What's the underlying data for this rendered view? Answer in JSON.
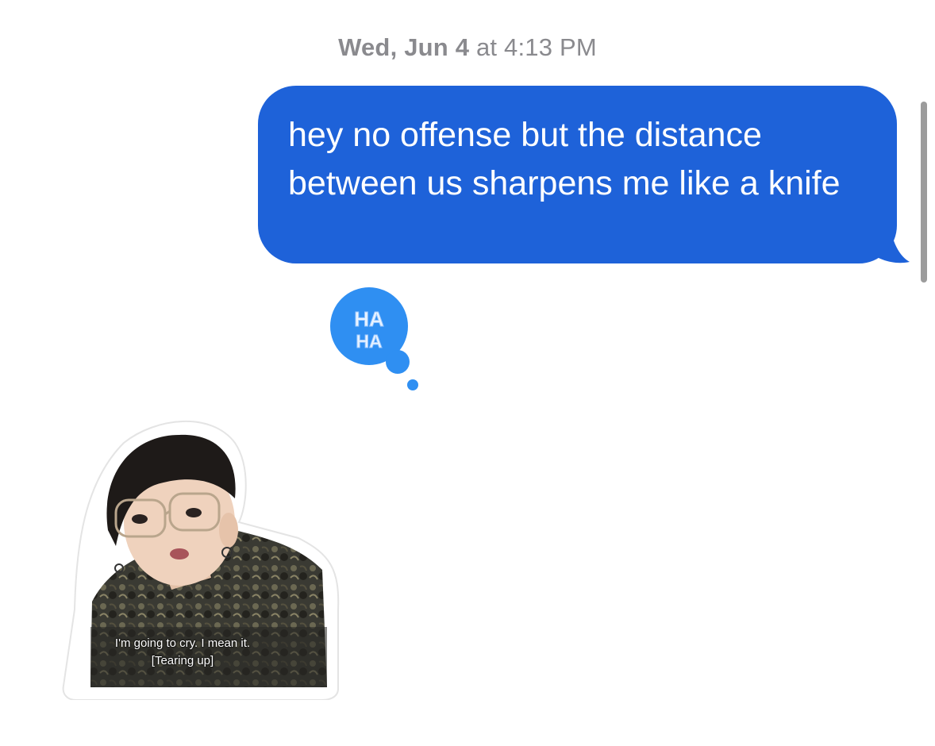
{
  "timestamp": {
    "day": "Wed, Jun 4",
    "rest": " at 4:13 PM"
  },
  "message": {
    "text": "hey no offense but the distance between us sharpens me like a knife",
    "bubble_color": "#1e62d9"
  },
  "tapback": {
    "icon": "haha-tapback-icon",
    "text_line1": "HA",
    "text_line2": "HA",
    "color": "#2f8ff2"
  },
  "sticker": {
    "caption_line1": "I'm going to cry. I mean it.",
    "caption_line2": "[Tearing up]"
  }
}
